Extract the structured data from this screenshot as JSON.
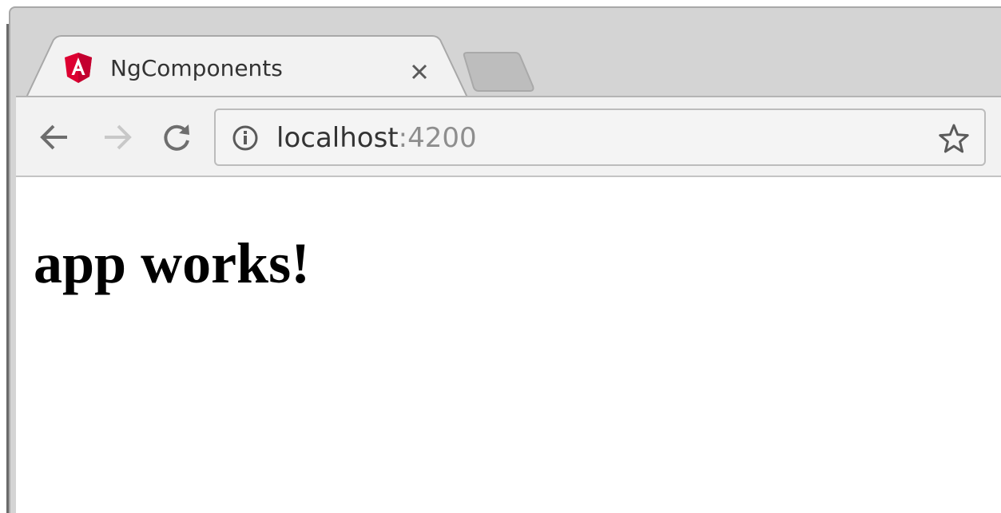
{
  "tab": {
    "title": "NgComponents",
    "favicon": "angular-icon",
    "close_icon": "close-icon"
  },
  "toolbar": {
    "back_icon": "back-arrow-icon",
    "forward_icon": "forward-arrow-icon",
    "forward_enabled": false,
    "reload_icon": "reload-icon"
  },
  "address_bar": {
    "host": "localhost",
    "port": ":4200",
    "info_icon": "info-icon",
    "bookmark_icon": "star-icon"
  },
  "page": {
    "heading": "app works!"
  },
  "colors": {
    "tab_strip": "#d4d4d4",
    "toolbar": "#f2f2f2",
    "angular_red": "#dd0031",
    "icon_gray": "#6e6e6e",
    "disabled_icon": "#c8c8c8"
  }
}
